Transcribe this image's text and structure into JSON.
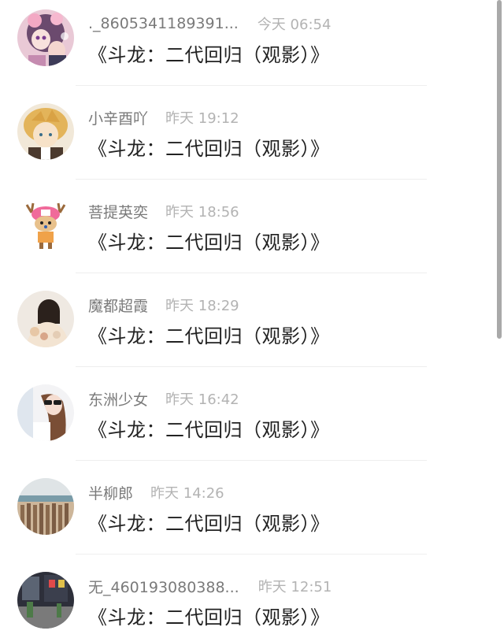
{
  "comments": [
    {
      "user": "._8605341189391...",
      "time": "今天 06:54",
      "title": "《斗龙：二代回归（观影）》",
      "avatar": "anime-girl-avatar"
    },
    {
      "user": "小辛酉吖",
      "time": "昨天 19:12",
      "title": "《斗龙：二代回归（观影）》",
      "avatar": "blonde-anime-boy-avatar"
    },
    {
      "user": "菩提英奕",
      "time": "昨天 18:56",
      "title": "《斗龙：二代回归（观影）》",
      "avatar": "chopper-reindeer-avatar"
    },
    {
      "user": "魔都超霞",
      "time": "昨天 18:29",
      "title": "《斗龙：二代回归（观影）》",
      "avatar": "girl-back-avatar"
    },
    {
      "user": "东洲少女",
      "time": "昨天 16:42",
      "title": "《斗龙：二代回归（观影）》",
      "avatar": "sunglasses-girl-avatar"
    },
    {
      "user": "半柳郎",
      "time": "昨天 14:26",
      "title": "《斗龙：二代回归（观影）》",
      "avatar": "beach-fence-avatar"
    },
    {
      "user": "无_460193080388...",
      "time": "昨天 12:51",
      "title": "《斗龙：二代回归（观影）》",
      "avatar": "street-scene-avatar"
    }
  ]
}
